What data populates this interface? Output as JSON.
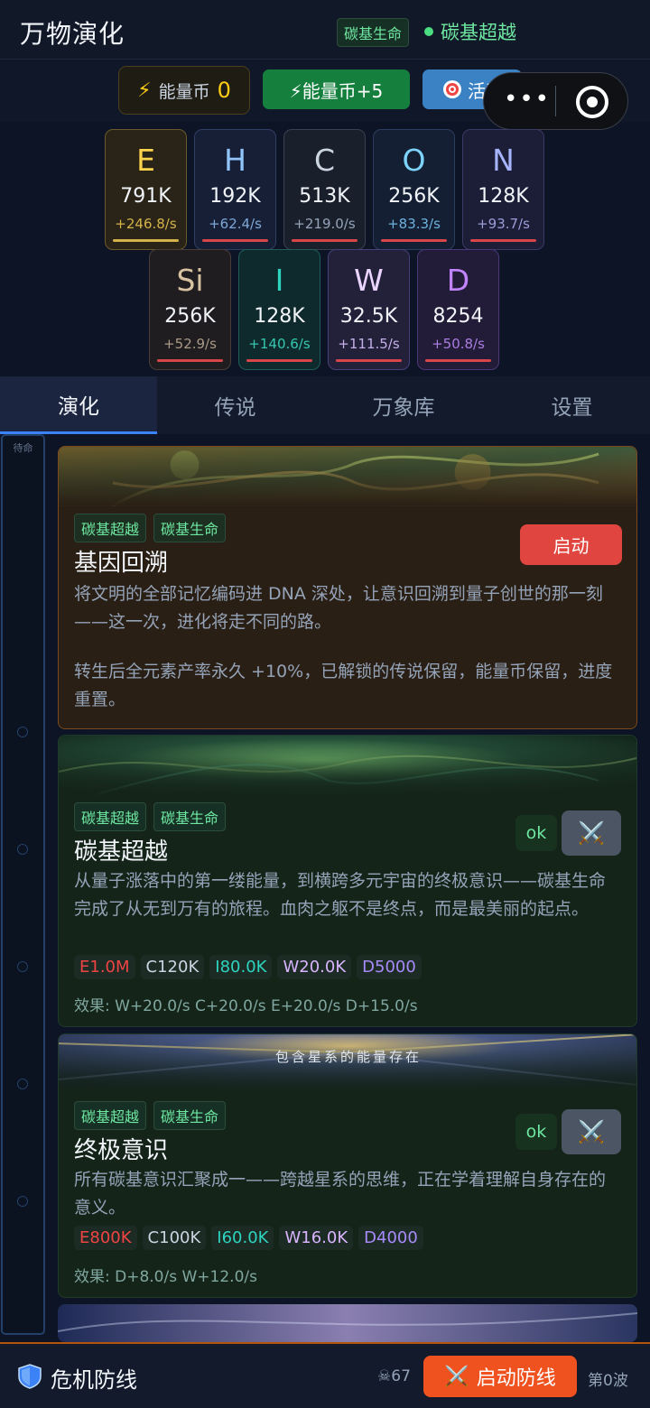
{
  "header": {
    "title": "万物演化",
    "tag": "碳基生命",
    "status": "碳基超越"
  },
  "actions": {
    "coin_label": "能量币",
    "coin_value": "0",
    "plus": "⚡能量币+5",
    "activity": "活动"
  },
  "elements": [
    {
      "sym": "E",
      "amount": "791K",
      "rate": "+246.8/s",
      "color": "#fcd34d",
      "rate_color": "#d4b24a"
    },
    {
      "sym": "H",
      "amount": "192K",
      "rate": "+62.4/s",
      "color": "#93c5fd",
      "rate_color": "#7ea7d6"
    },
    {
      "sym": "C",
      "amount": "513K",
      "rate": "+219.0/s",
      "color": "#cbd5e1",
      "rate_color": "#94a3b8"
    },
    {
      "sym": "O",
      "amount": "256K",
      "rate": "+83.3/s",
      "color": "#7dd3fc",
      "rate_color": "#6cb2dc"
    },
    {
      "sym": "N",
      "amount": "128K",
      "rate": "+93.7/s",
      "color": "#a5b4fc",
      "rate_color": "#9a9ed8"
    },
    {
      "sym": "Si",
      "amount": "256K",
      "rate": "+52.9/s",
      "color": "#d6c2a0",
      "rate_color": "#a89a86"
    },
    {
      "sym": "I",
      "amount": "128K",
      "rate": "+140.6/s",
      "color": "#2dd4bf",
      "rate_color": "#34c7b0"
    },
    {
      "sym": "W",
      "amount": "32.5K",
      "rate": "+111.5/s",
      "color": "#e9d5ff",
      "rate_color": "#c4b0e6"
    },
    {
      "sym": "D",
      "amount": "8254",
      "rate": "+50.8/s",
      "color": "#c084fc",
      "rate_color": "#a87ce0"
    }
  ],
  "tabs": [
    "演化",
    "传说",
    "万象库",
    "设置"
  ],
  "rail_label": "待命",
  "cards": [
    {
      "tags": [
        "碳基超越",
        "碳基生命"
      ],
      "title": "基因回溯",
      "button": "启动",
      "desc1": "将文明的全部记忆编码进 DNA 深处，让意识回溯到量子创世的那一刻——这一次，进化将走不同的路。",
      "desc2": "转生后全元素产率永久 +10%，已解锁的传说保留，能量币保留，进度重置。"
    },
    {
      "tags": [
        "碳基超越",
        "碳基生命"
      ],
      "title": "碳基超越",
      "ok": "ok",
      "desc": "从量子涨落中的第一缕能量，到横跨多元宇宙的终极意识——碳基生命完成了从无到万有的旅程。血肉之躯不是终点，而是最美丽的起点。",
      "costs": [
        {
          "text": "E1.0M",
          "color": "#ef4444"
        },
        {
          "text": "C120K",
          "color": "#cbd5e1"
        },
        {
          "text": "I80.0K",
          "color": "#2dd4bf"
        },
        {
          "text": "W20.0K",
          "color": "#d8b4fe"
        },
        {
          "text": "D5000",
          "color": "#a78bfa"
        }
      ],
      "effect": "效果: W+20.0/s  C+20.0/s  E+20.0/s  D+15.0/s"
    },
    {
      "tags": [
        "碳基超越",
        "碳基生命"
      ],
      "title": "终极意识",
      "ok": "ok",
      "banner_text": "包含星系的能量存在",
      "desc": "所有碳基意识汇聚成一——跨越星系的思维，正在学着理解自身存在的意义。",
      "costs": [
        {
          "text": "E800K",
          "color": "#ef4444"
        },
        {
          "text": "C100K",
          "color": "#cbd5e1"
        },
        {
          "text": "I60.0K",
          "color": "#2dd4bf"
        },
        {
          "text": "W16.0K",
          "color": "#d8b4fe"
        },
        {
          "text": "D4000",
          "color": "#a78bfa"
        }
      ],
      "effect": "效果: D+8.0/s  W+12.0/s"
    }
  ],
  "footer": {
    "title": "危机防线",
    "skull_count": "67",
    "button": "启动防线",
    "wave": "第0波"
  }
}
